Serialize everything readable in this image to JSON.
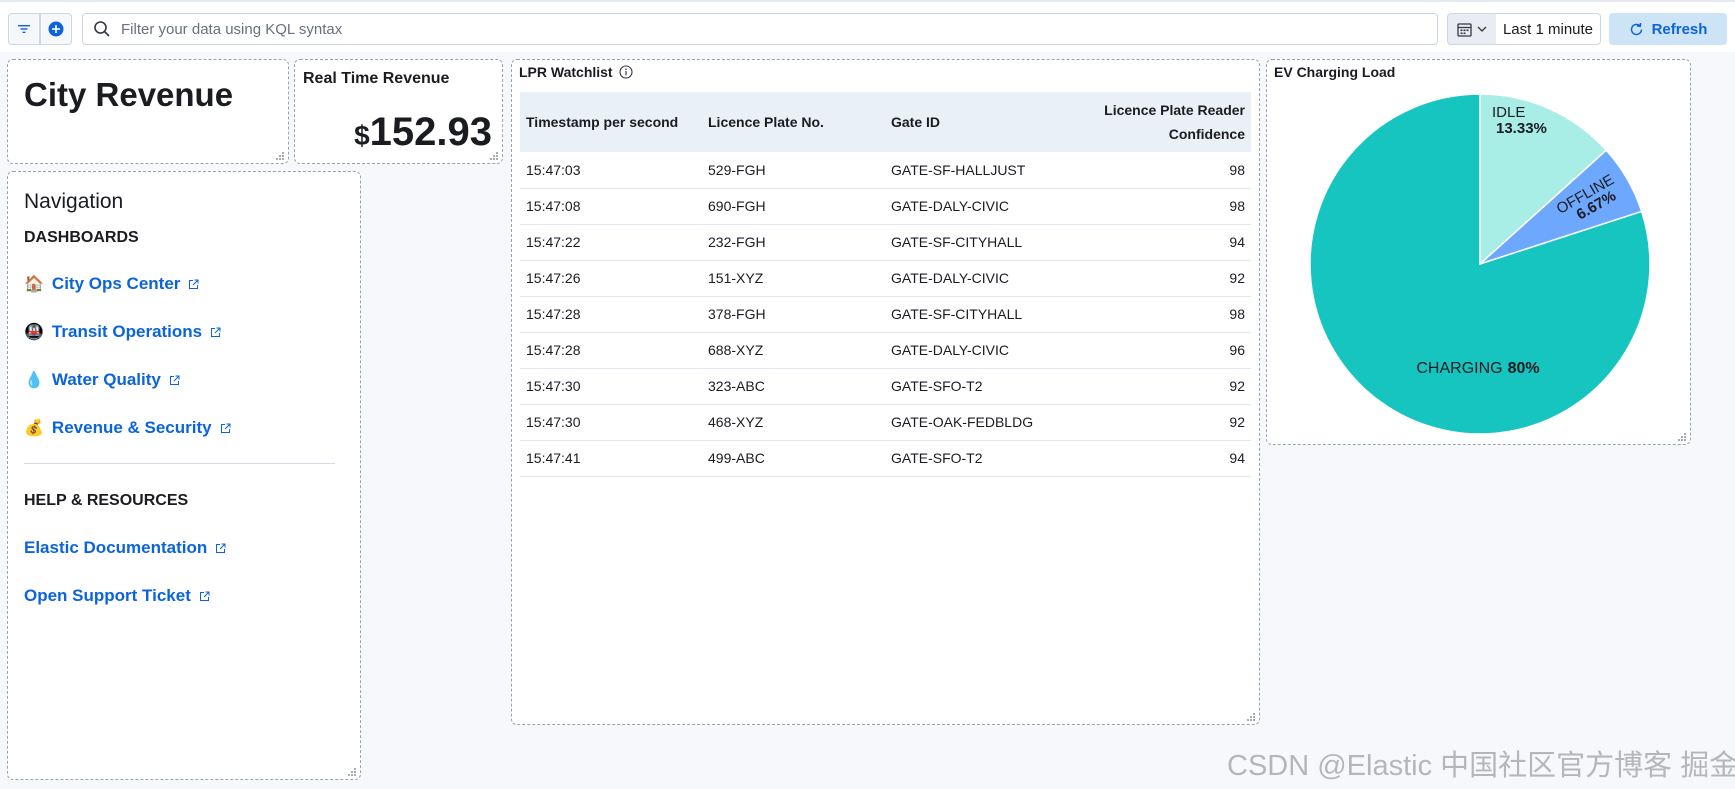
{
  "query_bar": {
    "search_placeholder": "Filter your data using KQL syntax",
    "time_range": "Last 1 minute",
    "refresh_label": "Refresh"
  },
  "panels": {
    "city_revenue": {
      "title": "City Revenue"
    },
    "real_time_revenue": {
      "title": "Real Time Revenue",
      "currency": "$",
      "value": "152.93"
    },
    "navigation": {
      "heading": "Navigation",
      "dashboards_label": "DASHBOARDS",
      "dashboards": [
        {
          "emoji": "🏠",
          "label": "City Ops Center"
        },
        {
          "emoji": "🚇",
          "label": "Transit Operations"
        },
        {
          "emoji": "💧",
          "label": "Water Quality"
        },
        {
          "emoji": "💰",
          "label": "Revenue & Security"
        }
      ],
      "help_label": "HELP & RESOURCES",
      "help_links": [
        {
          "label": "Elastic Documentation"
        },
        {
          "label": "Open Support Ticket"
        }
      ]
    },
    "lpr_watchlist": {
      "title": "LPR Watchlist",
      "columns": [
        "Timestamp per second",
        "Licence Plate No.",
        "Gate ID",
        "Licence Plate Reader Confidence"
      ],
      "rows": [
        [
          "15:47:03",
          "529-FGH",
          "GATE-SF-HALLJUST",
          "98"
        ],
        [
          "15:47:08",
          "690-FGH",
          "GATE-DALY-CIVIC",
          "98"
        ],
        [
          "15:47:22",
          "232-FGH",
          "GATE-SF-CITYHALL",
          "94"
        ],
        [
          "15:47:26",
          "151-XYZ",
          "GATE-DALY-CIVIC",
          "92"
        ],
        [
          "15:47:28",
          "378-FGH",
          "GATE-SF-CITYHALL",
          "98"
        ],
        [
          "15:47:28",
          "688-XYZ",
          "GATE-DALY-CIVIC",
          "96"
        ],
        [
          "15:47:30",
          "323-ABC",
          "GATE-SFO-T2",
          "92"
        ],
        [
          "15:47:30",
          "468-XYZ",
          "GATE-OAK-FEDBLDG",
          "92"
        ],
        [
          "15:47:41",
          "499-ABC",
          "GATE-SFO-T2",
          "94"
        ]
      ]
    },
    "ev_charging": {
      "title": "EV Charging Load"
    }
  },
  "chart_data": {
    "type": "pie",
    "title": "EV Charging Load",
    "slices": [
      {
        "label": "IDLE",
        "value": 13.33,
        "display": "13.33%",
        "color": "#a8ede6"
      },
      {
        "label": "OFFLINE",
        "value": 6.67,
        "display": "6.67%",
        "color": "#6ea8fe"
      },
      {
        "label": "CHARGING",
        "value": 80,
        "display": "80%",
        "color": "#16c5c0"
      }
    ]
  },
  "watermark": "CSDN @Elastic 中国社区官方博客 掘金技术社区 @ Elasticsearch"
}
